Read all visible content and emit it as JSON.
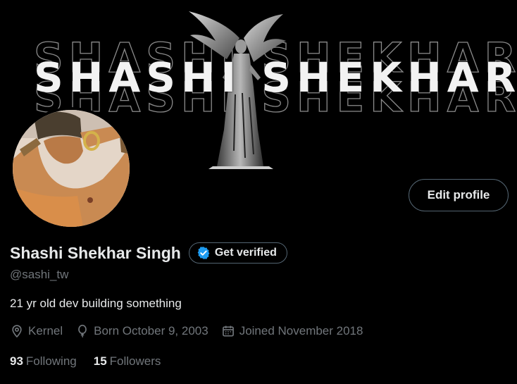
{
  "banner": {
    "title": "SHASHI SHEKHAR"
  },
  "profile": {
    "display_name": "Shashi Shekhar Singh",
    "verify_label": "Get verified",
    "handle": "@sashi_tw",
    "bio": "21 yr old dev building something",
    "edit_label": "Edit profile",
    "verified_color": "#1d9bf0"
  },
  "meta": {
    "location": "Kernel",
    "birthday": "Born October 9, 2003",
    "joined": "Joined November 2018"
  },
  "stats": {
    "following_count": "93",
    "following_label": "Following",
    "followers_count": "15",
    "followers_label": "Followers"
  }
}
